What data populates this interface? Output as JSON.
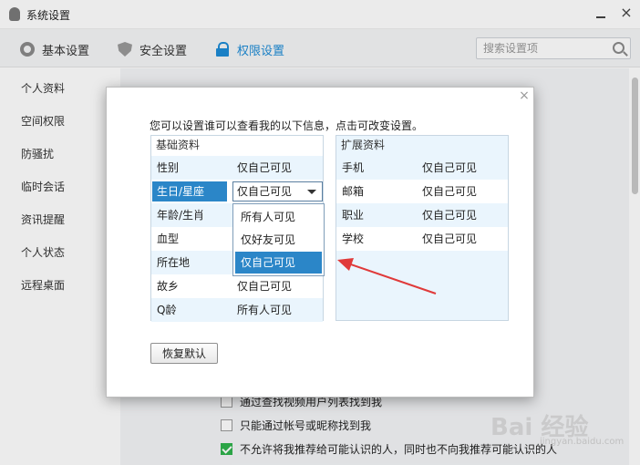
{
  "window": {
    "title": "系统设置",
    "close_glyph": "×"
  },
  "tabs": {
    "basic": "基本设置",
    "security": "安全设置",
    "permission": "权限设置"
  },
  "search": {
    "placeholder": "搜索设置项"
  },
  "sidebar": {
    "items": [
      "个人资料",
      "空间权限",
      "防骚扰",
      "临时会话",
      "资讯提醒",
      "个人状态",
      "远程桌面"
    ]
  },
  "background_options": [
    {
      "label": "通过查找视频用户列表找到我",
      "checked": false
    },
    {
      "label": "只能通过帐号或昵称找到我",
      "checked": false
    },
    {
      "label": "不允许将我推荐给可能认识的人，同时也不向我推荐可能认识的人",
      "checked": true
    }
  ],
  "dialog": {
    "close_glyph": "×",
    "instruction": "您可以设置谁可以查看我的以下信息，点击可改变设置。",
    "basic": {
      "header": "基础资料",
      "rows": [
        {
          "key": "性别",
          "value": "仅自己可见"
        },
        {
          "key": "生日/星座",
          "value": "仅自己可见"
        },
        {
          "key": "年龄/生肖",
          "value": ""
        },
        {
          "key": "血型",
          "value": ""
        },
        {
          "key": "所在地",
          "value": ""
        },
        {
          "key": "故乡",
          "value": "仅自己可见"
        },
        {
          "key": "Q龄",
          "value": "所有人可见"
        }
      ]
    },
    "extended": {
      "header": "扩展资料",
      "rows": [
        {
          "key": "手机",
          "value": "仅自己可见"
        },
        {
          "key": "邮箱",
          "value": "仅自己可见"
        },
        {
          "key": "职业",
          "value": "仅自己可见"
        },
        {
          "key": "学校",
          "value": "仅自己可见"
        }
      ]
    },
    "dropdown": {
      "selected": "仅自己可见",
      "options": [
        "所有人可见",
        "仅好友可见",
        "仅自己可见"
      ]
    },
    "restore_button": "恢复默认"
  },
  "colors": {
    "accent": "#1d8bd6",
    "selection": "#2b86c8",
    "annotation_arrow": "#e03a3a"
  },
  "watermark": {
    "main": "Bai 经验",
    "sub": "jingyan.baidu.com"
  }
}
